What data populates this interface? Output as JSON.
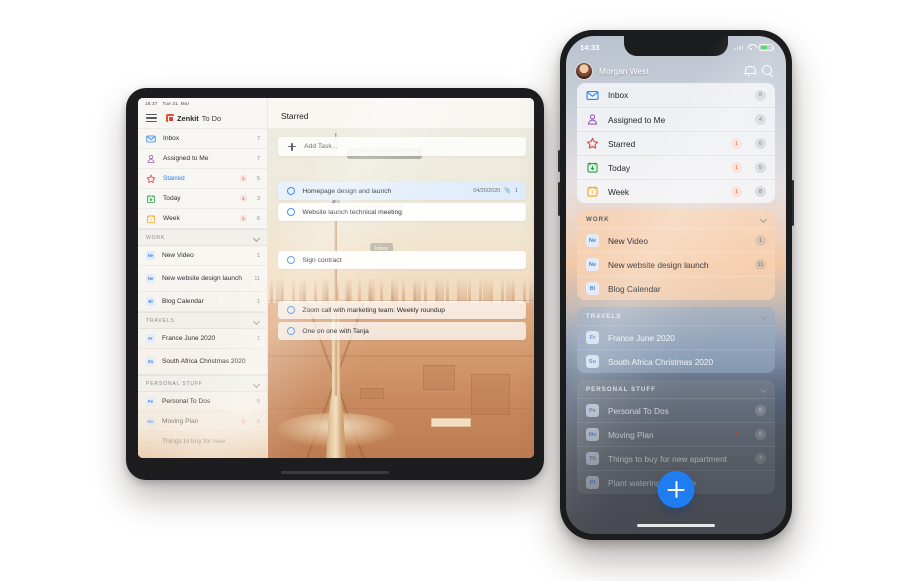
{
  "tablet": {
    "status": {
      "time": "16:37",
      "date": "Tue 31. Mar"
    },
    "brand": {
      "name": "Zenkit",
      "suffix": "To Do",
      "logo_icon": "zenkit-logo-icon"
    },
    "menu_icon": "hamburger-menu-icon",
    "smart_lists": [
      {
        "label": "Inbox",
        "icon": "envelope-icon",
        "badge": "",
        "count": "7",
        "selected": false
      },
      {
        "label": "Assigned to Me",
        "icon": "person-icon",
        "badge": "",
        "count": "7",
        "selected": false
      },
      {
        "label": "Starred",
        "icon": "star-icon",
        "badge": "1",
        "count": "5",
        "selected": true
      },
      {
        "label": "Today",
        "icon": "calendar-today-icon",
        "badge": "1",
        "count": "3",
        "selected": false
      },
      {
        "label": "Week",
        "icon": "calendar-week-icon",
        "badge": "1",
        "count": "6",
        "selected": false
      }
    ],
    "groups": [
      {
        "title": "WORK",
        "chevron_icon": "chevron-down-icon",
        "items": [
          {
            "label": "New Video",
            "abbr": "Ne",
            "count": "1"
          },
          {
            "label": "New website design launch",
            "abbr": "Ne",
            "count": "11"
          },
          {
            "label": "Blog Calendar",
            "abbr": "Bl",
            "count": "1"
          }
        ]
      },
      {
        "title": "TRAVELS",
        "chevron_icon": "chevron-down-icon",
        "items": [
          {
            "label": "France June 2020",
            "abbr": "Fr",
            "count": "1"
          },
          {
            "label": "South Africa Christmas 2020",
            "abbr": "So",
            "count": ""
          }
        ]
      },
      {
        "title": "PERSONAL STUFF",
        "chevron_icon": "chevron-down-icon",
        "items": [
          {
            "label": "Personal To Dos",
            "abbr": "Pe",
            "badge": "",
            "count": "5"
          },
          {
            "label": "Moving Plan",
            "abbr": "Mo",
            "badge": "1",
            "count": "6"
          },
          {
            "label": "Things to buy for new",
            "abbr": "Th",
            "badge": "",
            "count": ""
          }
        ]
      }
    ],
    "main": {
      "title": "Starred",
      "add_task_placeholder": "Add Task...",
      "add_icon": "plus-icon",
      "tasks": [
        {
          "text": "Homepage design and launch",
          "date": "04/20/2020",
          "attachments": "1",
          "attachment_icon": "paperclip-icon",
          "highlight": true
        },
        {
          "text": "Website launch technical meeting",
          "date": "",
          "attachments": "",
          "highlight": false
        },
        {
          "text": "Sign contract",
          "date": "",
          "attachments": "",
          "highlight": false
        },
        {
          "text": "Zoom call with marketing team: Weekly roundup",
          "date": "",
          "attachments": "",
          "highlight": false
        },
        {
          "text": "One on one with Tanja",
          "date": "",
          "attachments": "",
          "highlight": false
        }
      ],
      "tags": [
        "New website design launch",
        "Moving Plan",
        "Inbox"
      ]
    }
  },
  "phone": {
    "status": {
      "time": "14:33",
      "wifi_icon": "wifi-icon",
      "battery_icon": "battery-icon",
      "signal_icon": "signal-icon"
    },
    "header": {
      "user": "Morgan West",
      "avatar_icon": "avatar",
      "bell_icon": "bell-icon",
      "search_icon": "search-icon"
    },
    "smart_lists": [
      {
        "label": "Inbox",
        "icon": "envelope-icon",
        "badge": "",
        "count": "8"
      },
      {
        "label": "Assigned to Me",
        "icon": "person-icon",
        "badge": "",
        "count": "4"
      },
      {
        "label": "Starred",
        "icon": "star-icon",
        "badge": "1",
        "count": "6"
      },
      {
        "label": "Today",
        "icon": "calendar-today-icon",
        "badge": "1",
        "count": "5"
      },
      {
        "label": "Week",
        "icon": "calendar-week-icon",
        "badge": "1",
        "count": "8"
      }
    ],
    "groups": [
      {
        "title": "WORK",
        "chevron_icon": "chevron-down-icon",
        "items": [
          {
            "label": "New Video",
            "abbr": "Ne",
            "badge": "",
            "count": "1"
          },
          {
            "label": "New website design launch",
            "abbr": "Ne",
            "badge": "",
            "count": "11"
          },
          {
            "label": "Blog Calendar",
            "abbr": "Bl",
            "badge": "",
            "count": ""
          }
        ]
      },
      {
        "title": "TRAVELS",
        "chevron_icon": "chevron-down-icon",
        "items": [
          {
            "label": "France June 2020",
            "abbr": "Fr",
            "badge": "",
            "count": ""
          },
          {
            "label": "South Africa Christmas 2020",
            "abbr": "So",
            "badge": "",
            "count": ""
          }
        ]
      },
      {
        "title": "PERSONAL STUFF",
        "chevron_icon": "chevron-down-icon",
        "items": [
          {
            "label": "Personal To Dos",
            "abbr": "Pe",
            "badge": "",
            "count": "5"
          },
          {
            "label": "Moving Plan",
            "abbr": "Mo",
            "badge": "1",
            "count": "6"
          },
          {
            "label": "Things to buy for new apartment",
            "abbr": "Th",
            "badge": "",
            "count": "7"
          },
          {
            "label": "Plant watering schedule",
            "abbr": "Pl",
            "badge": "",
            "count": ""
          }
        ]
      }
    ],
    "fab": {
      "icon": "plus-icon",
      "color": "#1f7df0"
    }
  },
  "colors": {
    "accent_blue": "#2b7cf0",
    "badge_red": "#e24b2a",
    "star_red": "#e8403a",
    "today_green": "#2aa14a",
    "week_orange": "#f0a422",
    "inbox_blue": "#2f86e8",
    "person_purple": "#9a5fc0"
  }
}
